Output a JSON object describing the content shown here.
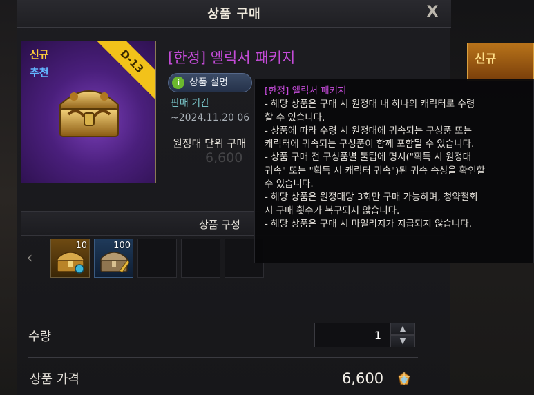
{
  "window": {
    "title": "상품 구매",
    "close_glyph": "X"
  },
  "product": {
    "badge_new": "신규",
    "badge_recommended": "추천",
    "ribbon_text": "D-13",
    "name": "[한정] 엘릭서 패키지",
    "desc_button_label": "상품 설명",
    "sale_period_label": "판매 기간",
    "sale_period_value": "~2024.11.20  06",
    "limit_text": "원정대 단위 구매",
    "ghost_price": "6,600"
  },
  "composition": {
    "title": "상품 구성",
    "items": [
      {
        "count": "10",
        "icon": "treasure-chest-with-potion-icon",
        "style": "gold"
      },
      {
        "count": "100",
        "icon": "treasure-chest-with-horn-icon",
        "style": "blue"
      },
      {
        "count": "",
        "icon": "",
        "style": "empty"
      },
      {
        "count": "",
        "icon": "",
        "style": "empty"
      },
      {
        "count": "",
        "icon": "",
        "style": "empty"
      },
      {
        "count": "",
        "icon": "",
        "style": "empty"
      }
    ],
    "nav_prev_glyph": "‹"
  },
  "purchase": {
    "quantity_label": "수량",
    "quantity_value": "1",
    "price_label": "상품 가격",
    "price_value": "6,600",
    "currency_icon": "crystal-icon"
  },
  "tooltip": {
    "title": "[한정] 엘릭서 패키지",
    "lines": [
      "- 해당 상품은 구매 시 원정대 내 하나의 캐릭터로 수령",
      "할 수 있습니다.",
      "- 상품에 따라 수령 시 원정대에 귀속되는 구성품 또는",
      "캐릭터에 귀속되는 구성품이 함께 포함될 수 있습니다.",
      "- 상품 구매 전 구성품별 툴팁에 명시(\"획득 시 원정대",
      "귀속\" 또는 \"획득 시 캐릭터 귀속\")된 귀속 속성을 확인할",
      "수 있습니다.",
      "- 해당 상품은 원정대당 3회만 구매 가능하며, 청약철회",
      "시 구매 횟수가 복구되지 않습니다.",
      "- 해당 상품은 구매 시 마일리지가 지급되지 않습니다."
    ]
  },
  "background": {
    "right_card_badge": "신규"
  },
  "colors": {
    "product_name": "#c44bd8",
    "badge_new": "#ffcc3a",
    "badge_recommended": "#63b6ff",
    "ribbon": "#f2c21a",
    "sale_label": "#77c0c4"
  }
}
